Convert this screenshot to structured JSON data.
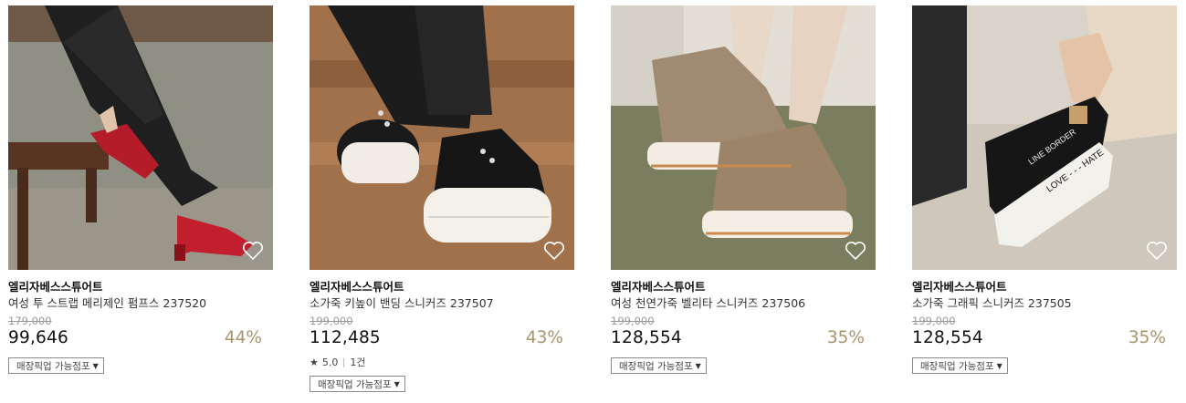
{
  "products": [
    {
      "brand": "엘리자베스스튜어트",
      "name": "여성 투 스트랩 메리제인 펌프스 237520",
      "original_price": "179,000",
      "price": "99,646",
      "discount": "44%",
      "pickup_label": "매장픽업 가능점포",
      "icon": "heart-outline-icon"
    },
    {
      "brand": "엘리자베스스튜어트",
      "name": "소가죽 키높이 밴딩 스니커즈 237507",
      "original_price": "199,000",
      "price": "112,485",
      "discount": "43%",
      "rating": "5.0",
      "review_count": "1건",
      "pickup_label": "매장픽업 가능점포",
      "icon": "heart-outline-icon"
    },
    {
      "brand": "엘리자베스스튜어트",
      "name": "여성 천연가죽 벨리타 스니커즈 237506",
      "original_price": "199,000",
      "price": "128,554",
      "discount": "35%",
      "pickup_label": "매장픽업 가능점포",
      "icon": "heart-outline-icon"
    },
    {
      "brand": "엘리자베스스튜어트",
      "name": "소가죽 그래픽 스니커즈 237505",
      "original_price": "199,000",
      "price": "128,554",
      "discount": "35%",
      "pickup_label": "매장픽업 가능점포",
      "icon": "heart-outline-icon"
    }
  ],
  "colors": {
    "discount": "#a8946b",
    "price": "#111111",
    "original_price": "#9a9a9a"
  }
}
